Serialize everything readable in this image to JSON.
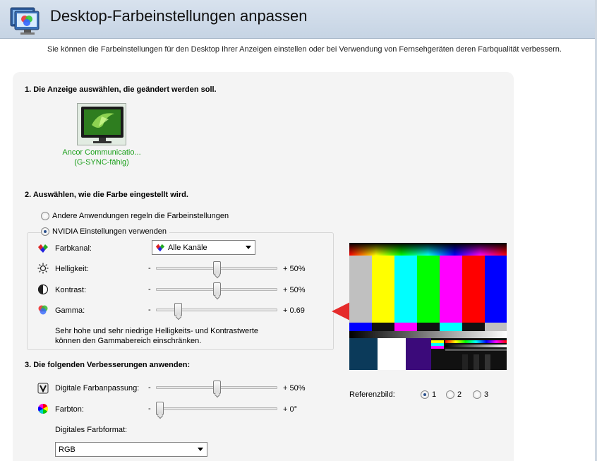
{
  "header": {
    "title": "Desktop-Farbeinstellungen anpassen"
  },
  "subtitle": "Sie können die Farbeinstellungen für den Desktop Ihrer Anzeigen einstellen oder bei Verwendung von Fernsehgeräten deren Farbqualität verbessern.",
  "section1": {
    "title": "1. Die Anzeige auswählen, die geändert werden soll.",
    "display": {
      "name": "Ancor Communicatio...",
      "subtitle": "(G-SYNC-fähig)"
    }
  },
  "section2": {
    "title": "2. Auswählen, wie die Farbe eingestellt wird.",
    "option_other": "Andere Anwendungen regeln die Farbeinstellungen",
    "option_nvidia": "NVIDIA Einstellungen verwenden",
    "selected_option": "nvidia",
    "channel": {
      "label": "Farbkanal:",
      "value": "Alle Kanäle"
    },
    "brightness": {
      "label": "Helligkeit:",
      "minus": "-",
      "plus": "+",
      "value": "50%",
      "level": 0.5
    },
    "contrast": {
      "label": "Kontrast:",
      "minus": "-",
      "plus": "+",
      "value": "50%",
      "level": 0.5
    },
    "gamma": {
      "label": "Gamma:",
      "minus": "-",
      "plus": "+",
      "value": "0.69",
      "level": 0.16
    },
    "note_line1": "Sehr hohe und sehr niedrige Helligkeits- und Kontrastwerte",
    "note_line2": "können den Gammabereich einschränken."
  },
  "section3": {
    "title": "3. Die folgenden Verbesserungen anwenden:",
    "vibrance": {
      "label": "Digitale Farbanpassung:",
      "minus": "-",
      "plus": "+",
      "value": "50%",
      "level": 0.5
    },
    "hue": {
      "label": "Farbton:",
      "minus": "-",
      "plus": "+",
      "value": "0°",
      "level": 0.0
    },
    "format_label": "Digitales Farbformat:",
    "format_value": "RGB"
  },
  "reference": {
    "label": "Referenzbild:",
    "options": [
      "1",
      "2",
      "3"
    ],
    "selected": "1"
  },
  "colors": {
    "accent_green": "#1b9f1b",
    "arrow_red": "#e52b2b",
    "header_bg": "#c6d4e4"
  }
}
